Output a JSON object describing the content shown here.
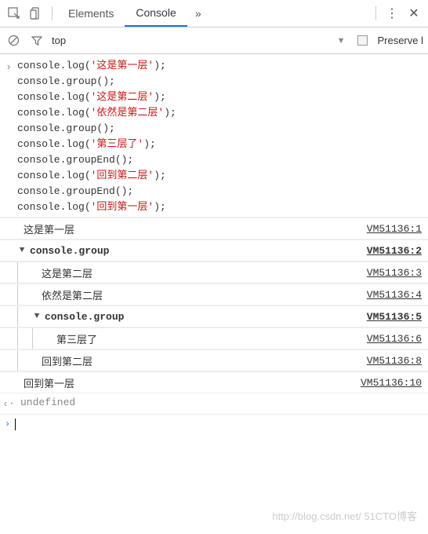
{
  "header": {
    "tab_elements": "Elements",
    "tab_console": "Console"
  },
  "toolbar": {
    "context": "top",
    "preserve_label": "Preserve l"
  },
  "input": {
    "lines": [
      {
        "pre": "console.log(",
        "str": "'这是第一层'",
        "post": ");"
      },
      {
        "pre": "console.group();",
        "str": "",
        "post": ""
      },
      {
        "pre": "console.log(",
        "str": "'这是第二层'",
        "post": ");"
      },
      {
        "pre": "console.log(",
        "str": "'依然是第二层'",
        "post": ");"
      },
      {
        "pre": "console.group();",
        "str": "",
        "post": ""
      },
      {
        "pre": "console.log(",
        "str": "'第三层了'",
        "post": ");"
      },
      {
        "pre": "console.groupEnd();",
        "str": "",
        "post": ""
      },
      {
        "pre": "console.log(",
        "str": "'回到第二层'",
        "post": ");"
      },
      {
        "pre": "console.groupEnd();",
        "str": "",
        "post": ""
      },
      {
        "pre": "console.log(",
        "str": "'回到第一层'",
        "post": ");"
      }
    ]
  },
  "output": [
    {
      "indent": 0,
      "bars": 0,
      "disc": "",
      "bold": false,
      "text": "这是第一层",
      "link": "VM51136:1"
    },
    {
      "indent": 0,
      "bars": 0,
      "disc": "▼",
      "bold": true,
      "text": "console.group",
      "link": "VM51136:2"
    },
    {
      "indent": 1,
      "bars": 1,
      "disc": "",
      "bold": false,
      "text": "这是第二层",
      "link": "VM51136:3"
    },
    {
      "indent": 1,
      "bars": 1,
      "disc": "",
      "bold": false,
      "text": "依然是第二层",
      "link": "VM51136:4"
    },
    {
      "indent": 1,
      "bars": 1,
      "disc": "▼",
      "bold": true,
      "text": "console.group",
      "link": "VM51136:5"
    },
    {
      "indent": 2,
      "bars": 2,
      "disc": "",
      "bold": false,
      "text": "第三层了",
      "link": "VM51136:6"
    },
    {
      "indent": 1,
      "bars": 1,
      "disc": "",
      "bold": false,
      "text": "回到第二层",
      "link": "VM51136:8"
    },
    {
      "indent": 0,
      "bars": 0,
      "disc": "",
      "bold": false,
      "text": "回到第一层",
      "link": "VM51136:10"
    }
  ],
  "result": {
    "value": "undefined"
  },
  "watermark": "http://blog.csdn.net/  51CTO博客"
}
